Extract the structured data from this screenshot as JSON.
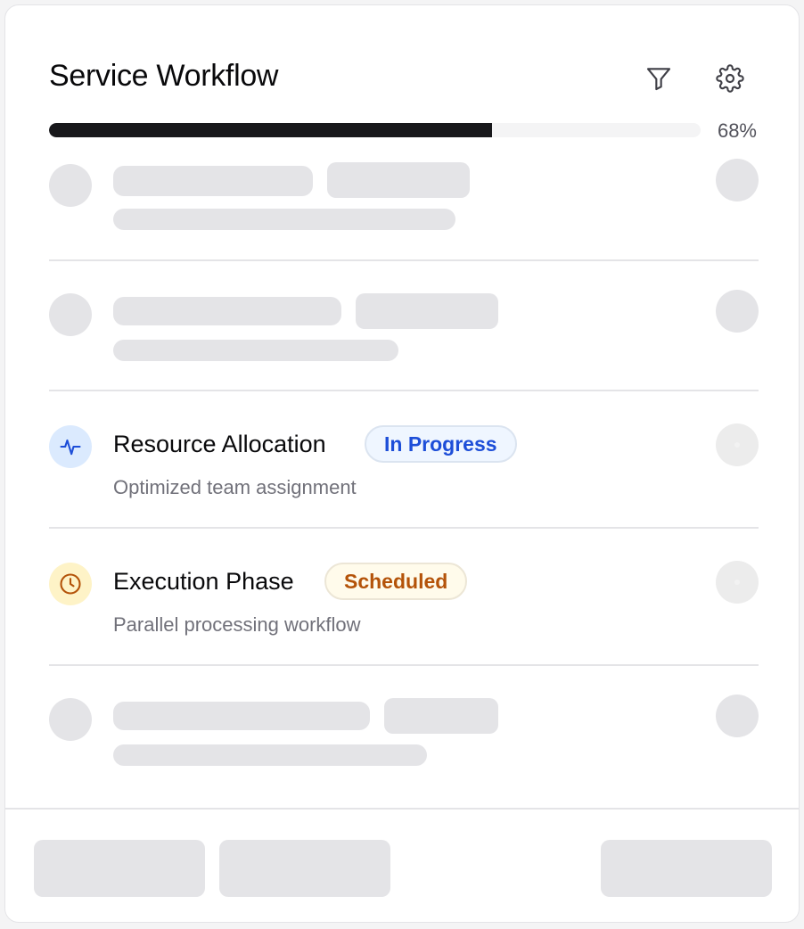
{
  "header": {
    "title": "Service Workflow",
    "filter_icon": "filter-icon",
    "settings_icon": "gear-icon"
  },
  "progress": {
    "value": 0.68,
    "label": "68%"
  },
  "colors": {
    "progress_fill": "#18181b",
    "skeleton": "#e4e4e7",
    "in_progress_text": "#1d4ed8",
    "in_progress_bg": "#eff6ff",
    "in_progress_icon_bg": "#dbeafe",
    "scheduled_text": "#b45309",
    "scheduled_bg": "#fffbeb",
    "scheduled_icon_bg": "#fef3c7"
  },
  "rows": [
    {
      "type": "skeleton"
    },
    {
      "type": "skeleton"
    },
    {
      "type": "item",
      "icon": "activity-icon",
      "title": "Resource Allocation",
      "status": "In Progress",
      "description": "Optimized team assignment"
    },
    {
      "type": "item",
      "icon": "clock-icon",
      "title": "Execution Phase",
      "status": "Scheduled",
      "description": "Parallel processing workflow"
    },
    {
      "type": "skeleton"
    }
  ],
  "footer": {
    "buttons": [
      "skeleton",
      "skeleton",
      "skeleton"
    ]
  }
}
